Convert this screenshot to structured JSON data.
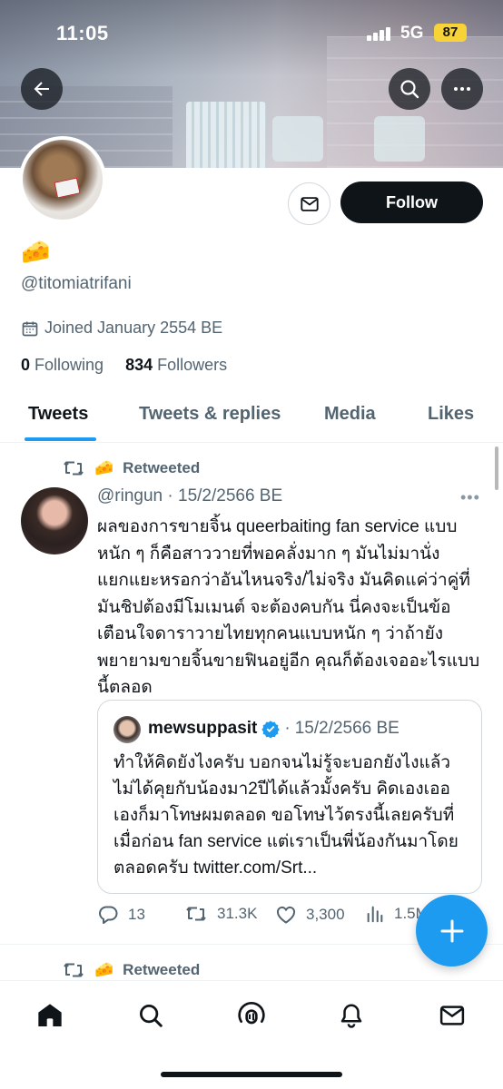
{
  "status_bar": {
    "time": "11:05",
    "network": "5G",
    "battery": "87"
  },
  "profile": {
    "display_name": "🧀",
    "handle": "@titomiatrifani",
    "joined": "Joined January 2554 BE",
    "following_count": "0",
    "following_label": "Following",
    "followers_count": "834",
    "followers_label": "Followers",
    "follow_label": "Follow"
  },
  "tabs": [
    {
      "label": "Tweets",
      "active": true
    },
    {
      "label": "Tweets & replies"
    },
    {
      "label": "Media"
    },
    {
      "label": "Likes"
    }
  ],
  "tweet": {
    "retweeted_by": "🧀",
    "retweeted_label": "Retweeted",
    "handle": "@ringun",
    "separator": "·",
    "date": "15/2/2566 BE",
    "text": "ผลของการขายจิ้น queerbaiting fan service แบบหนัก ๆ ก็คือสาววายที่พอคลั่งมาก ๆ มันไม่มานั่งแยกแยะหรอกว่าอันไหนจริง/ไม่จริง มันคิดแค่ว่าคู่ที่มันชิปต้องมีโมเมนต์ จะต้องคบกัน นี่คงจะเป็นข้อเตือนใจดาราวายไทยทุกคนแบบหนัก ๆ ว่าถ้ายังพยายามขายจิ้นขายฟินอยู่อีก คุณก็ต้องเจออะไรแบบนี้ตลอด",
    "quote": {
      "name": "mewsuppasit",
      "date": "15/2/2566 BE",
      "text": "ทำให้คิดยังไงครับ บอกจนไม่รู้จะบอกยังไงแล้ว ไม่ได้คุยกับน้องมา2ปีได้แล้วมั้งครับ คิดเองเออเองก็มาโทษผมตลอด ขอโทษไว้ตรงนี้เลยครับที่เมื่อก่อน fan service แต่เราเป็นพี่น้องกันมาโดยตลอดครับ twitter.com/Srt..."
    },
    "replies": "13",
    "retweets": "31.3K",
    "likes": "3,300",
    "views": "1.5M"
  },
  "next_tweet": {
    "retweeted_by": "🧀",
    "retweeted_label": "Retweeted"
  },
  "colors": {
    "accent": "#1d9bf0",
    "text": "#0f1419",
    "secondary": "#536471",
    "verified": "#1d9bf0"
  },
  "icons": [
    "back-arrow-icon",
    "search-icon",
    "more-icon",
    "mail-icon",
    "calendar-icon",
    "retweet-icon",
    "reply-icon",
    "like-icon",
    "views-icon",
    "plus-icon",
    "home-icon",
    "spaces-icon",
    "bell-icon",
    "messages-icon",
    "verified-icon"
  ]
}
